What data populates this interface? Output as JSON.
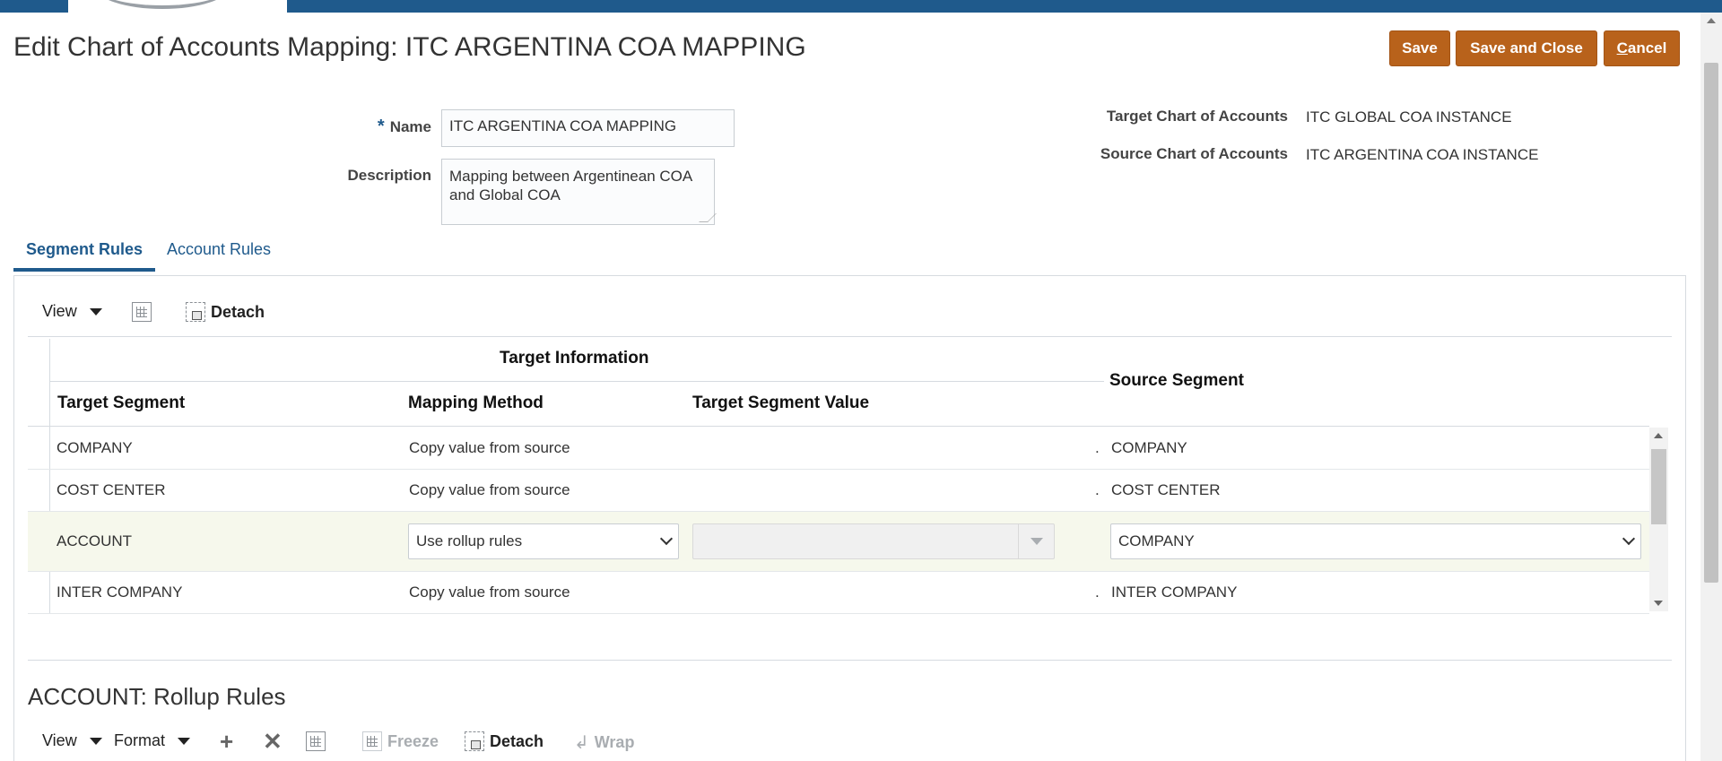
{
  "page": {
    "title": "Edit Chart of Accounts Mapping: ITC ARGENTINA COA MAPPING"
  },
  "actions": {
    "save": "Save",
    "save_close": "Save and Close",
    "cancel_first": "C",
    "cancel_rest": "ancel"
  },
  "form": {
    "name_required_mark": "*",
    "name_label": "Name",
    "name_value": "ITC ARGENTINA COA MAPPING",
    "description_label": "Description",
    "description_value": "Mapping between Argentinean COA\nand Global COA",
    "target_coa_label": "Target Chart of Accounts",
    "target_coa_value": "ITC GLOBAL COA INSTANCE",
    "source_coa_label": "Source Chart of Accounts",
    "source_coa_value": "ITC ARGENTINA COA INSTANCE"
  },
  "tabs": [
    {
      "label": "Segment Rules",
      "active": true
    },
    {
      "label": "Account Rules",
      "active": false
    }
  ],
  "toolbar": {
    "view": "View",
    "detach": "Detach"
  },
  "table": {
    "group_header": "Target Information",
    "columns": [
      "Target Segment",
      "Mapping Method",
      "Target Segment Value",
      "Source Segment"
    ],
    "rows": [
      {
        "target_segment": "COMPANY",
        "mapping_method": "Copy value from source",
        "target_value": "",
        "dot": ".",
        "source_segment": "COMPANY",
        "editable": false
      },
      {
        "target_segment": "COST CENTER",
        "mapping_method": "Copy value from source",
        "target_value": "",
        "dot": ".",
        "source_segment": "COST CENTER",
        "editable": false
      },
      {
        "target_segment": "ACCOUNT",
        "mapping_method": "Use rollup rules",
        "target_value": "",
        "dot": "",
        "source_segment": "COMPANY",
        "editable": true
      },
      {
        "target_segment": "INTER COMPANY",
        "mapping_method": "Copy value from source",
        "target_value": "",
        "dot": ".",
        "source_segment": "INTER COMPANY",
        "editable": false
      }
    ]
  },
  "rollup": {
    "title": "ACCOUNT: Rollup Rules",
    "view": "View",
    "format": "Format",
    "freeze": "Freeze",
    "detach": "Detach",
    "wrap": "Wrap"
  },
  "colors": {
    "accent": "#1f5a8c",
    "button": "#b8621b",
    "selected_row": "#f6f8ec"
  }
}
